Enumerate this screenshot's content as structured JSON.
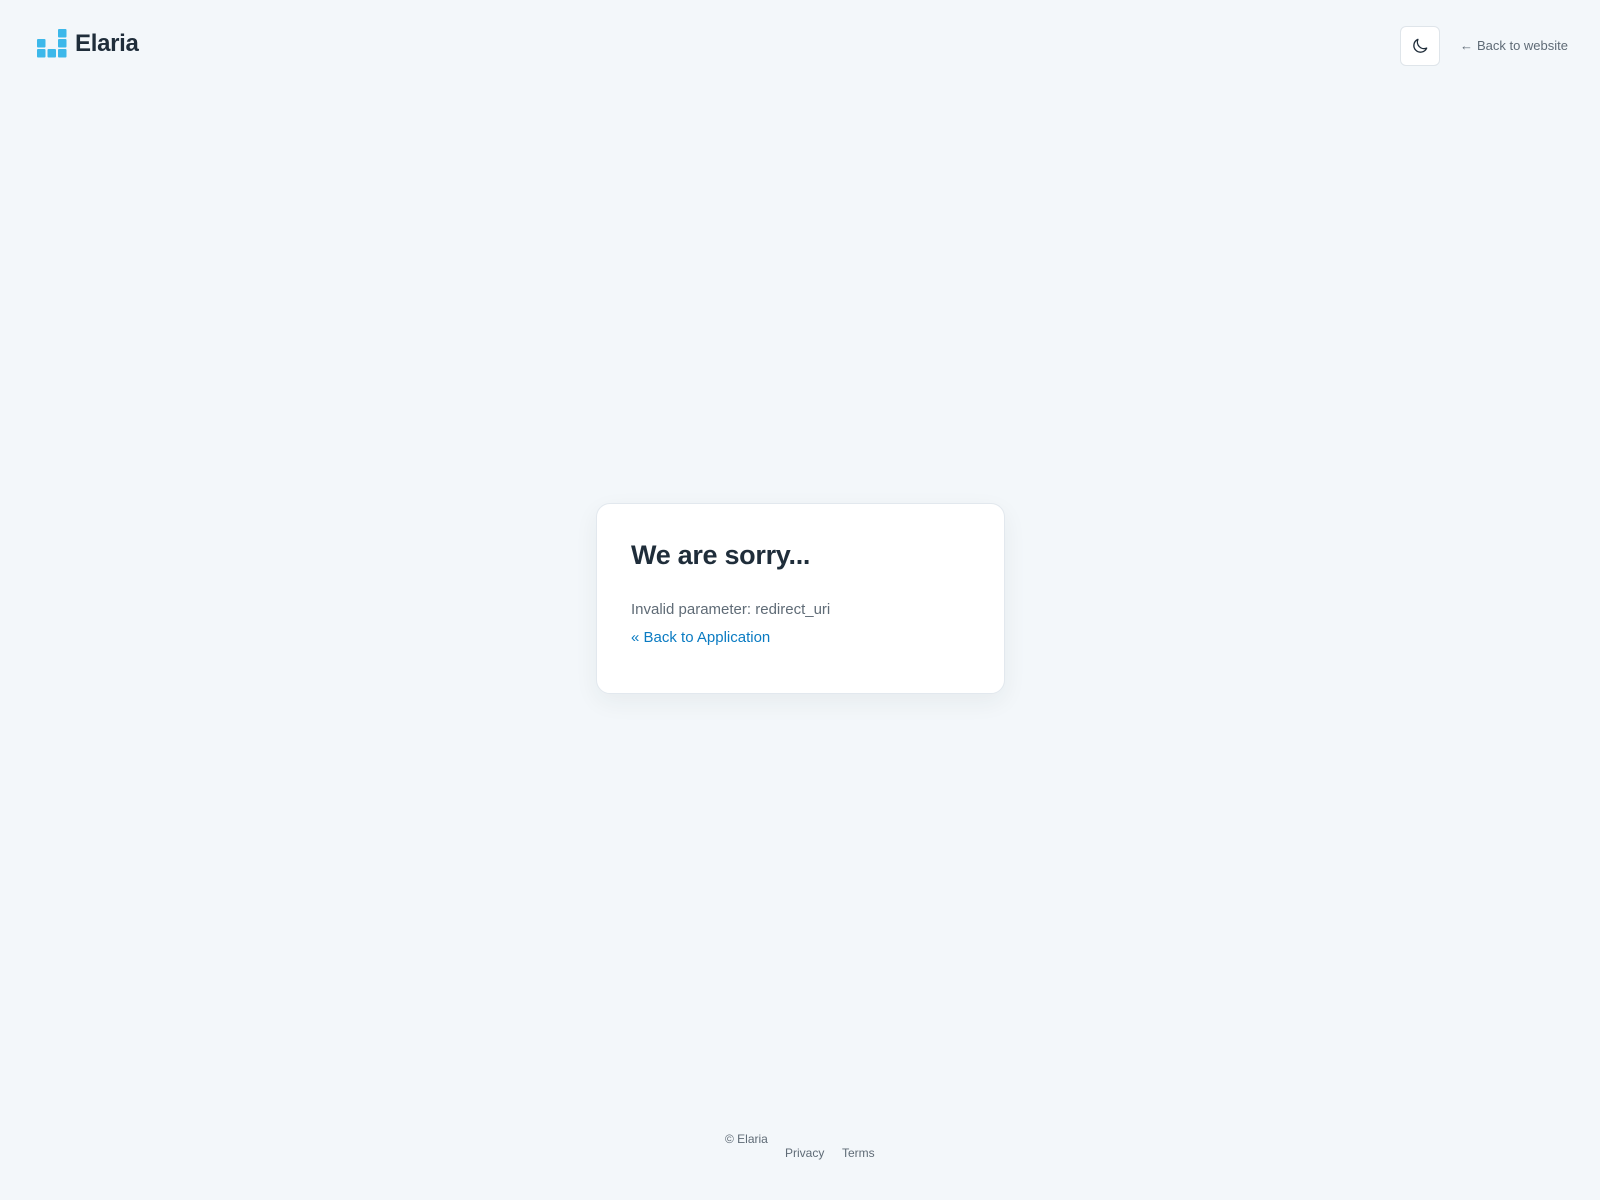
{
  "brand": {
    "name": "Elaria",
    "logo_icon": "bar-blocks-logo-icon",
    "logo_color": "#3cb8ea"
  },
  "header": {
    "theme_toggle_icon": "moon-icon",
    "back_link_arrow": "←",
    "back_link_label": "Back to website"
  },
  "card": {
    "title": "We are sorry...",
    "message": "Invalid parameter: redirect_uri",
    "back_link": "« Back to Application"
  },
  "footer": {
    "copyright": "© Elaria",
    "privacy": "Privacy",
    "terms": "Terms"
  },
  "colors": {
    "background": "#f3f7fa",
    "link": "#0a7bc2",
    "text": "#1f2d3a",
    "muted": "#5f6b76"
  }
}
